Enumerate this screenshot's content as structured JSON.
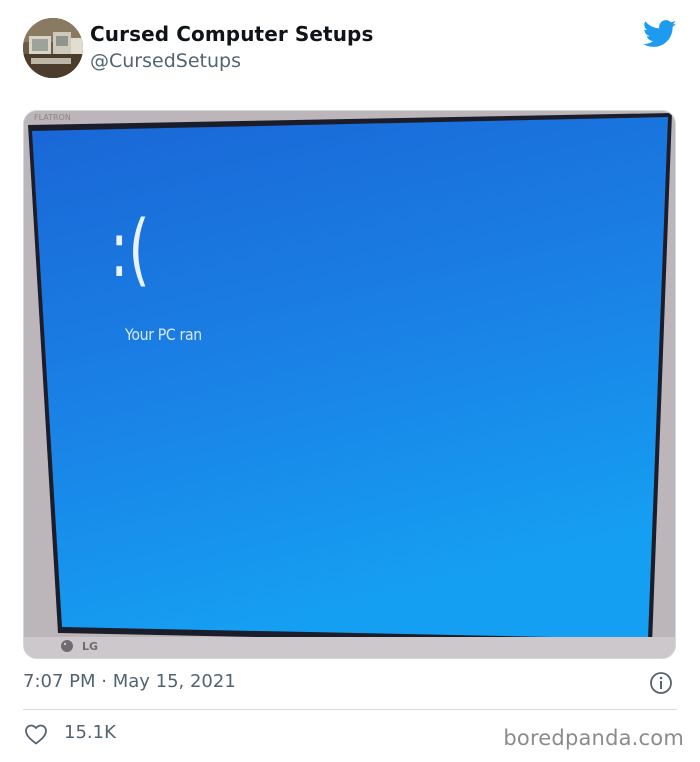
{
  "tweet": {
    "display_name": "Cursed Computer Setups",
    "handle": "@CursedSetups",
    "timestamp": "7:07 PM · May 15, 2021",
    "likes": "15.1K"
  },
  "media": {
    "bsod_face": ":(",
    "bsod_message": "Your PC ran",
    "monitor_brand": "LG"
  },
  "watermark": "boredpanda.com",
  "colors": {
    "twitter_blue": "#1d9bf0",
    "bsod_blue": "#1a7fe0",
    "text_secondary": "#536471",
    "divider": "#cfd9de"
  },
  "icons": {
    "brand": "twitter-bird-icon",
    "info": "info-icon",
    "like": "heart-icon"
  }
}
